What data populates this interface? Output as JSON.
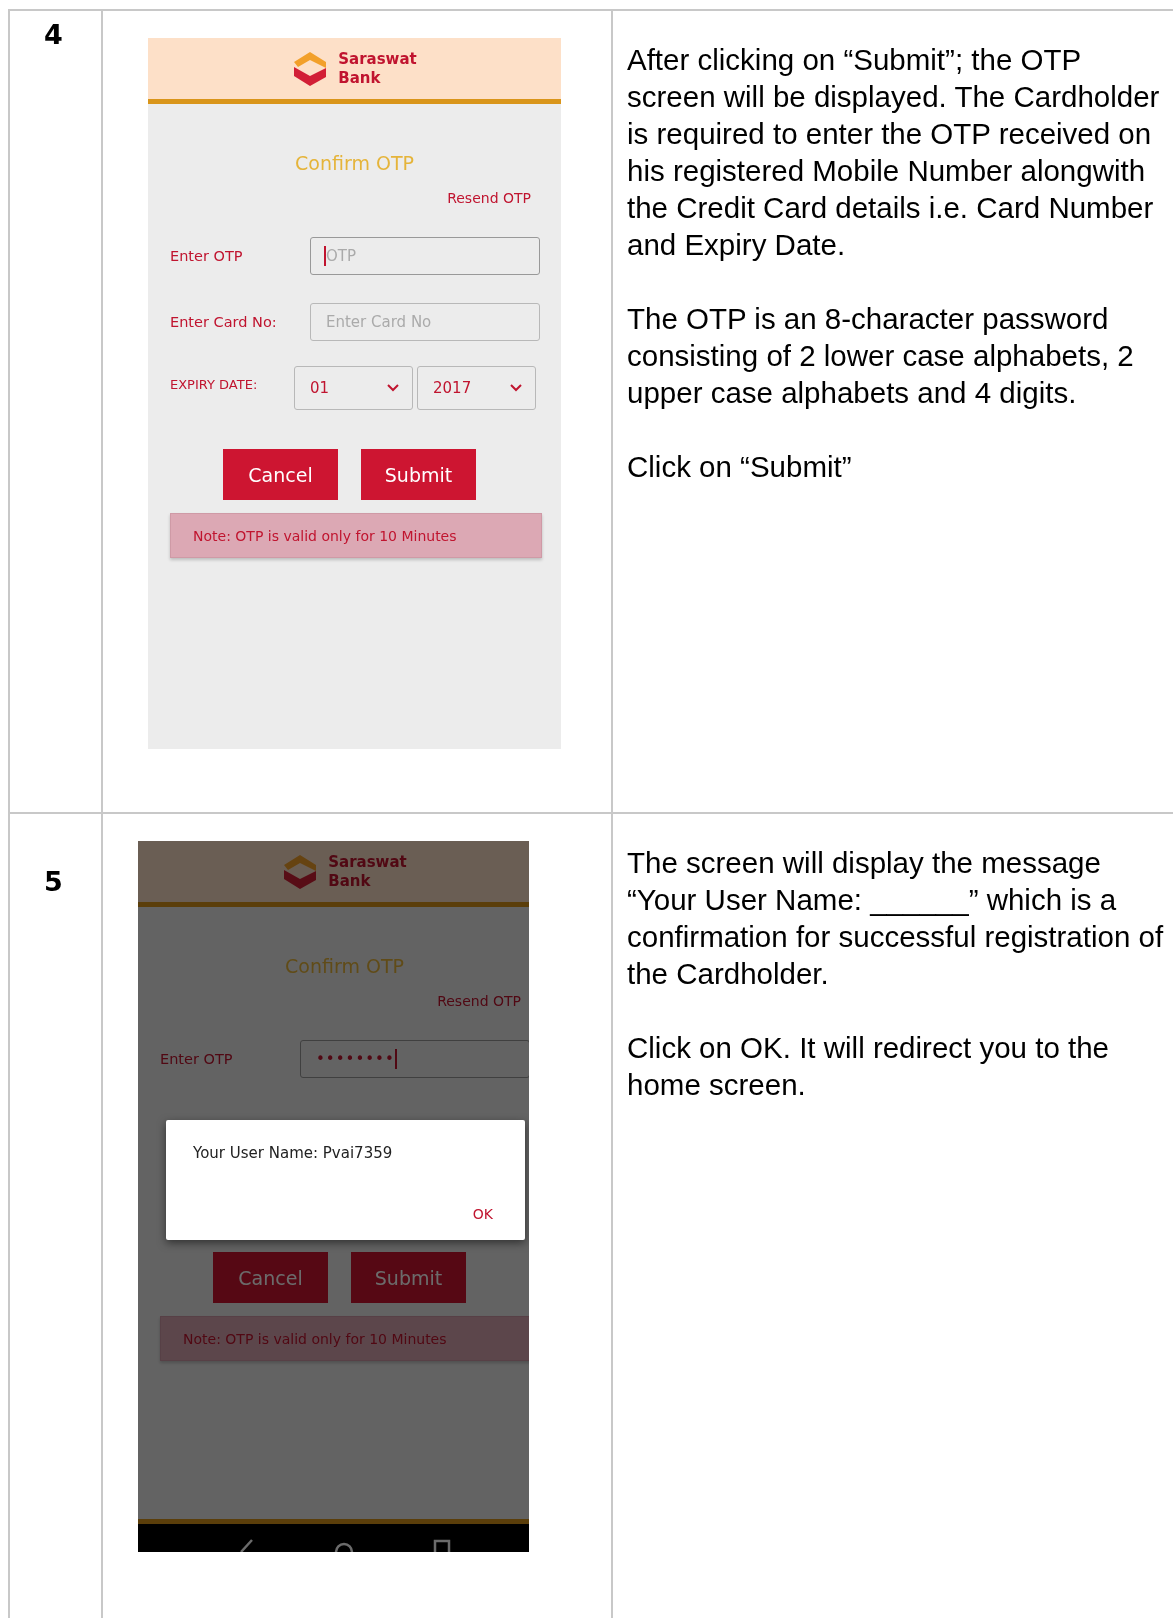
{
  "steps": [
    {
      "number": "4",
      "screen": {
        "dimmed": false,
        "bank_name": [
          "Saraswat",
          "Bank"
        ],
        "title": "Confirm OTP",
        "resend": "Resend OTP",
        "fields": [
          {
            "kind": "input",
            "label": "Enter OTP",
            "placeholder": "OTP",
            "focused": true
          },
          {
            "kind": "input",
            "label": "Enter Card No:",
            "placeholder": "Enter Card No",
            "focused": false
          },
          {
            "kind": "selects",
            "label": "EXPIRY DATE:",
            "options": [
              "01",
              "2017"
            ]
          }
        ],
        "buttons": [
          "Cancel",
          "Submit"
        ],
        "note": "Note: OTP is valid only for 10 Minutes",
        "nav_bar": false
      },
      "paragraphs": [
        "After clicking on “Submit”; the OTP screen will be displayed. The Cardholder is required to enter the OTP received on his registered Mobile Number alongwith the Credit Card details i.e. Card Number and Expiry Date.",
        "The OTP is an 8-character password consisting of 2 lower case alphabets, 2 upper case alphabets and 4 digits.",
        "Click on “Submit”"
      ]
    },
    {
      "number": "5",
      "screen": {
        "dimmed": true,
        "bank_name": [
          "Saraswat",
          "Bank"
        ],
        "title": "Confirm OTP",
        "resend": "Resend OTP",
        "fields": [
          {
            "kind": "input",
            "label": "Enter OTP",
            "value": "••••••••",
            "focused": true
          },
          {
            "kind": "hidden"
          },
          {
            "kind": "hidden"
          }
        ],
        "buttons": [
          "Cancel",
          "Submit"
        ],
        "note": "Note: OTP is valid only for 10 Minutes",
        "nav_bar": true,
        "dialog": {
          "message": "Your User Name: Pvai7359",
          "button": "OK"
        }
      },
      "paragraphs": [
        "The screen will display the message “Your User Name: ______” which is a confirmation for successful registration of the Cardholder.",
        "Click on OK. It will redirect you to the home screen."
      ]
    }
  ]
}
